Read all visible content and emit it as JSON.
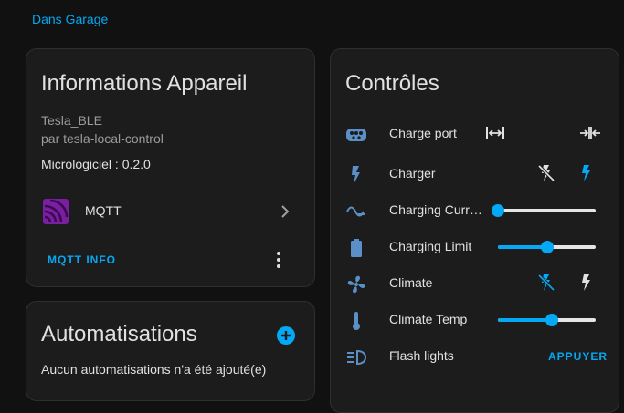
{
  "breadcrumb": "Dans Garage",
  "device_info": {
    "title": "Informations Appareil",
    "device_name": "Tesla_BLE",
    "manufacturer": "par tesla-local-control",
    "firmware": "Micrologiciel : 0.2.0",
    "integration": "MQTT",
    "action_label": "MQTT INFO"
  },
  "automations": {
    "title": "Automatisations",
    "empty_text": "Aucun automatisations n'a été ajouté(e)"
  },
  "controls": {
    "title": "Contrôles",
    "rows": [
      {
        "label": "Charge port"
      },
      {
        "label": "Charger"
      },
      {
        "label": "Charging Curr…",
        "level": 0.0
      },
      {
        "label": "Charging Limit",
        "level": 0.5
      },
      {
        "label": "Climate"
      },
      {
        "label": "Climate Temp",
        "level": 0.55
      },
      {
        "label": "Flash lights",
        "action": "APPUYER"
      }
    ]
  },
  "colors": {
    "accent": "#03a9f4",
    "icon": "#5a8fc7",
    "mqtt_logo": "#7b1fa2"
  },
  "icons": [
    "ev-plug-icon",
    "lightning-icon",
    "current-wave-icon",
    "battery-icon",
    "fan-icon",
    "thermometer-icon",
    "flash-lights-icon",
    "open-arrows-icon",
    "close-arrows-icon",
    "flash-off-icon",
    "mqtt-logo-icon",
    "chevron-right-icon",
    "more-vertical-icon",
    "add-circle-icon"
  ]
}
